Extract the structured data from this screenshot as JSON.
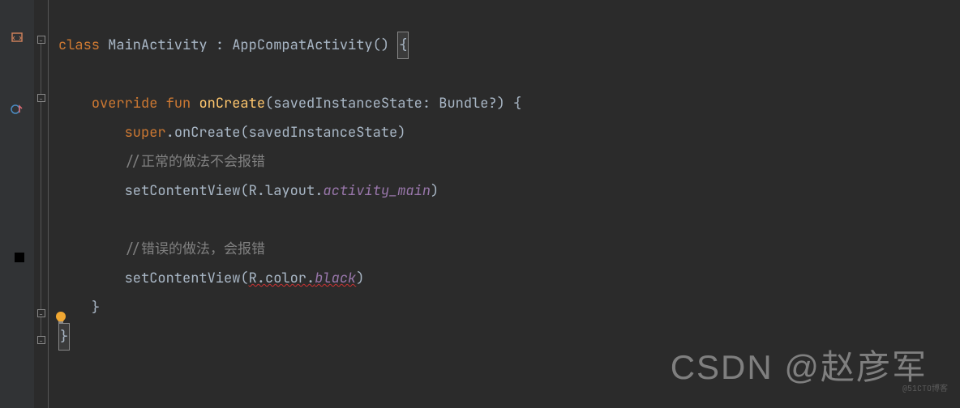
{
  "code": {
    "line1": {
      "class_kw": "class",
      "class_name": " MainActivity ",
      "colon": ": ",
      "parent": "AppCompatActivity() ",
      "brace": "{"
    },
    "line3": {
      "indent": "    ",
      "override_kw": "override ",
      "fun_kw": "fun ",
      "fn_name": "onCreate",
      "params_open": "(",
      "param_name": "savedInstanceState: ",
      "param_type": "Bundle?",
      "params_close": ") {",
      "full_params": "(savedInstanceState: Bundle?) {"
    },
    "line4": {
      "indent": "        ",
      "super_kw": "super",
      "dot": ".",
      "call": "onCreate(savedInstanceState)"
    },
    "line5": {
      "indent": "        ",
      "comment": "//正常的做法不会报错"
    },
    "line6": {
      "indent": "        ",
      "call": "setContentView(R.layout.",
      "resource": "activity_main",
      "close": ")"
    },
    "line8": {
      "indent": "        ",
      "comment": "//错误的做法，会报错"
    },
    "line9": {
      "indent": "        ",
      "call": "setContentView(",
      "error_part": "R.color.",
      "resource": "black",
      "close": ")"
    },
    "line10": {
      "indent": "    ",
      "brace": "}"
    },
    "line11": {
      "brace": "}"
    }
  },
  "watermark": {
    "main": "CSDN @赵彦军",
    "small": "@51CTO博客"
  }
}
